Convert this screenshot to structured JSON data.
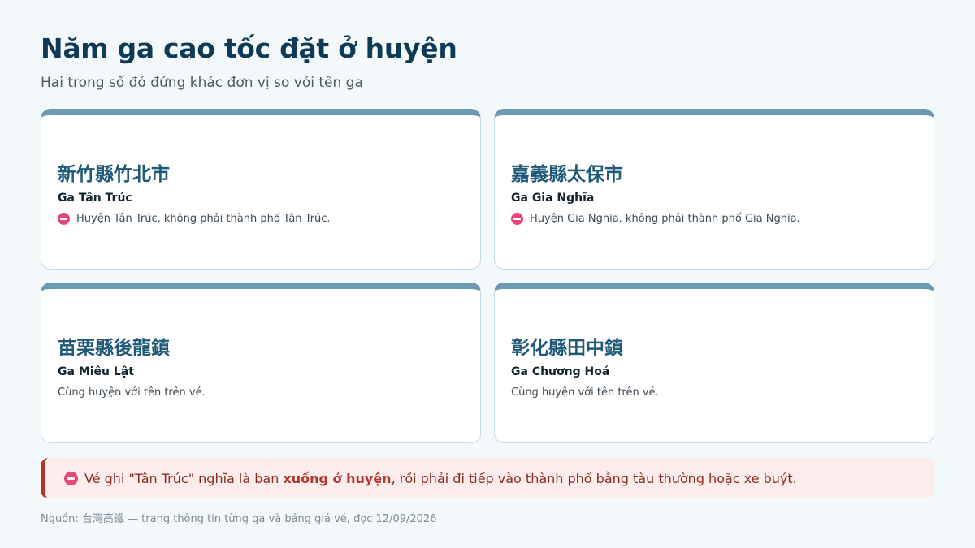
{
  "header": {
    "title": "Năm ga cao tốc đặt ở huyện",
    "subtitle": "Hai trong số đó đứng khác đơn vị so với tên ga"
  },
  "cards": [
    {
      "name": "新竹縣竹北市",
      "station": "Ga Tân Trúc",
      "note": "Huyện Tân Trúc, không phải thành phố Tân Trúc.",
      "warning": true
    },
    {
      "name": "嘉義縣太保市",
      "station": "Ga Gia Nghĩa",
      "note": "Huyện Gia Nghĩa, không phải thành phố Gia Nghĩa.",
      "warning": true
    },
    {
      "name": "苗栗縣後龍鎮",
      "station": "Ga Miêu Lật",
      "note": "Cùng huyện với tên trên vé.",
      "warning": false
    },
    {
      "name": "彰化縣田中鎮",
      "station": "Ga Chương Hoá",
      "note": "Cùng huyện với tên trên vé.",
      "warning": false
    }
  ],
  "callout": {
    "text_before": "Vé ghi \"Tân Trúc\" nghĩa là bạn ",
    "text_bold": "xuống ở huyện",
    "text_after": ", rồi phải đi tiếp vào thành phố bằng tàu thường hoặc xe buýt."
  },
  "footer": {
    "source": "Nguồn: 台灣高鐵 — trang thông tin từng ga và bảng giá vé, đọc 12/09/2026"
  },
  "colors": {
    "accent": "#6a9ab2",
    "title": "#0f3a55",
    "warning_icon": "#e8457a",
    "callout_border": "#b3362c",
    "callout_bg": "#fcecec"
  },
  "icons": {
    "warning": "stop-icon"
  }
}
